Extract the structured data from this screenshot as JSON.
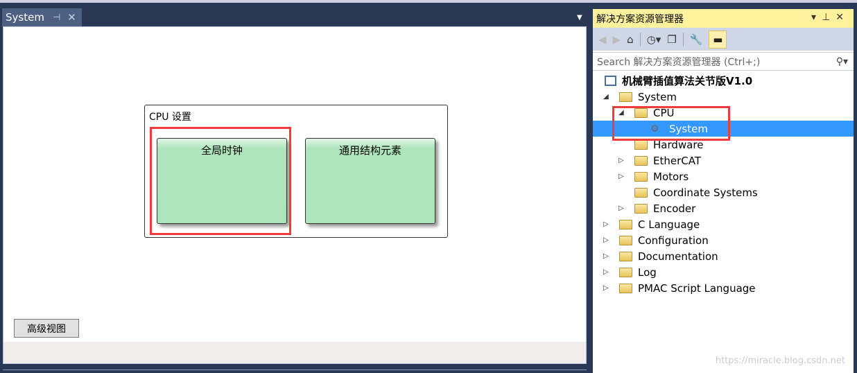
{
  "document_tab": {
    "title": "System",
    "pin_icon": "pin-icon",
    "close_icon": "close-icon"
  },
  "doc": {
    "group_label": "CPU 设置",
    "cards": [
      {
        "label": "全局时钟"
      },
      {
        "label": "通用结构元素"
      }
    ],
    "advanced_button": "高级视图"
  },
  "solution_explorer": {
    "title": "解决方案资源管理器",
    "search_placeholder": "Search 解决方案资源管理器 (Ctrl+;)",
    "tree": [
      {
        "label": "机械臂插值算法关节版V1.0",
        "level": 0,
        "bold": true,
        "toggle": "none",
        "icon": "project"
      },
      {
        "label": "System",
        "level": 1,
        "toggle": "expanded",
        "icon": "folder-open"
      },
      {
        "label": "CPU",
        "level": 2,
        "toggle": "expanded",
        "icon": "folder-open"
      },
      {
        "label": "System",
        "level": 3,
        "toggle": "none",
        "icon": "config-file",
        "selected": true
      },
      {
        "label": "Hardware",
        "level": 2,
        "toggle": "none",
        "icon": "folder"
      },
      {
        "label": "EtherCAT",
        "level": 2,
        "toggle": "collapsed",
        "icon": "folder"
      },
      {
        "label": "Motors",
        "level": 2,
        "toggle": "collapsed",
        "icon": "folder"
      },
      {
        "label": "Coordinate Systems",
        "level": 2,
        "toggle": "none",
        "icon": "folder"
      },
      {
        "label": "Encoder",
        "level": 2,
        "toggle": "collapsed",
        "icon": "folder"
      },
      {
        "label": "C Language",
        "level": 1,
        "toggle": "collapsed",
        "icon": "folder"
      },
      {
        "label": "Configuration",
        "level": 1,
        "toggle": "collapsed",
        "icon": "folder"
      },
      {
        "label": "Documentation",
        "level": 1,
        "toggle": "collapsed",
        "icon": "folder"
      },
      {
        "label": "Log",
        "level": 1,
        "toggle": "collapsed",
        "icon": "folder"
      },
      {
        "label": "PMAC Script Language",
        "level": 1,
        "toggle": "collapsed",
        "icon": "folder"
      }
    ]
  },
  "watermark": "https://miracle.blog.csdn.net",
  "colors": {
    "selection": "#3399ff",
    "highlight_box": "#f03c3c",
    "card_fill": "#ade5ba",
    "title_bar": "#fff29d"
  }
}
